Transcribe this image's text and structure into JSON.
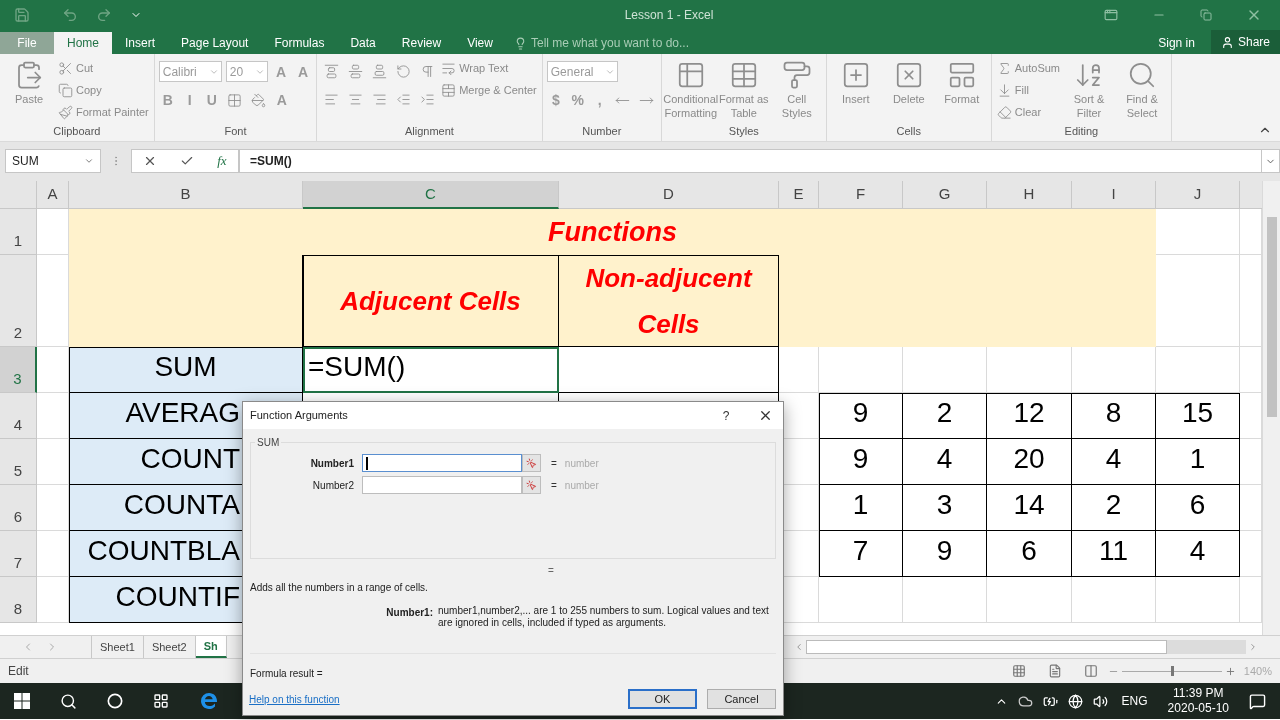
{
  "title_bar": {
    "title": "Lesson 1 - Excel"
  },
  "ribbon_tabs": [
    {
      "label": "File",
      "selected": false
    },
    {
      "label": "Home",
      "selected": true
    },
    {
      "label": "Insert",
      "selected": false
    },
    {
      "label": "Page Layout",
      "selected": false
    },
    {
      "label": "Formulas",
      "selected": false
    },
    {
      "label": "Data",
      "selected": false
    },
    {
      "label": "Review",
      "selected": false
    },
    {
      "label": "View",
      "selected": false
    }
  ],
  "tell_me": {
    "placeholder": "Tell me what you want to do..."
  },
  "account": {
    "sign_in": "Sign in",
    "share": "Share"
  },
  "ribbon_groups": [
    {
      "label": "Clipboard",
      "items": [
        {
          "kind": "large",
          "label": "Paste"
        },
        {
          "kind": "stack",
          "items": [
            {
              "label": "Cut"
            },
            {
              "label": "Copy"
            },
            {
              "label": "Format Painter"
            }
          ]
        }
      ]
    },
    {
      "label": "Font",
      "items": [
        {
          "kind": "rows",
          "lines": [
            [
              {
                "kind": "combo",
                "value": "Calibri"
              },
              {
                "kind": "combo",
                "value": "20"
              },
              {
                "kind": "glyph",
                "label": "A"
              },
              {
                "kind": "glyph",
                "label": "A"
              }
            ],
            [
              {
                "kind": "glyph",
                "label": "B"
              },
              {
                "kind": "glyph",
                "label": "I"
              },
              {
                "kind": "glyph",
                "label": "U"
              },
              {
                "kind": "icon"
              },
              {
                "kind": "icon"
              },
              {
                "kind": "glyph",
                "label": "A"
              }
            ]
          ]
        }
      ]
    },
    {
      "label": "Alignment",
      "items": [
        {
          "kind": "rows",
          "lines": [
            [
              {
                "kind": "icon"
              },
              {
                "kind": "icon"
              },
              {
                "kind": "icon"
              },
              {
                "kind": "icon"
              },
              {
                "kind": "icon"
              }
            ],
            [
              {
                "kind": "icon"
              },
              {
                "kind": "icon"
              },
              {
                "kind": "icon"
              },
              {
                "kind": "icon"
              },
              {
                "kind": "icon"
              }
            ]
          ]
        },
        {
          "kind": "stack",
          "items": [
            {
              "label": "Wrap Text"
            },
            {
              "label": "Merge & Center"
            }
          ]
        }
      ]
    },
    {
      "label": "Number",
      "items": [
        {
          "kind": "rows",
          "lines": [
            [
              {
                "kind": "combo",
                "value": "General"
              }
            ],
            [
              {
                "kind": "glyph",
                "label": "$"
              },
              {
                "kind": "glyph",
                "label": "%"
              },
              {
                "kind": "glyph",
                "label": ","
              },
              {
                "kind": "icon"
              },
              {
                "kind": "icon"
              }
            ]
          ]
        }
      ]
    },
    {
      "label": "Styles",
      "items": [
        {
          "kind": "large",
          "label": "Conditional Formatting"
        },
        {
          "kind": "large",
          "label": "Format as Table"
        },
        {
          "kind": "large",
          "label": "Cell Styles"
        }
      ]
    },
    {
      "label": "Cells",
      "items": [
        {
          "kind": "large",
          "label": "Insert"
        },
        {
          "kind": "large",
          "label": "Delete"
        },
        {
          "kind": "large",
          "label": "Format"
        }
      ]
    },
    {
      "label": "Editing",
      "items": [
        {
          "kind": "stack",
          "items": [
            {
              "label": "AutoSum"
            },
            {
              "label": "Fill"
            },
            {
              "label": "Clear"
            }
          ]
        },
        {
          "kind": "large",
          "label": "Sort & Filter"
        },
        {
          "kind": "large",
          "label": "Find & Select"
        }
      ]
    }
  ],
  "formula_bar": {
    "name_box": "SUM",
    "insert_function": "fx",
    "formula": "=SUM()"
  },
  "sheet": {
    "columns": [
      {
        "label": "A",
        "selected": false
      },
      {
        "label": "B",
        "selected": false
      },
      {
        "label": "C",
        "selected": true
      },
      {
        "label": "D",
        "selected": false
      },
      {
        "label": "E",
        "selected": false
      },
      {
        "label": "F",
        "selected": false
      },
      {
        "label": "G",
        "selected": false
      },
      {
        "label": "H",
        "selected": false
      },
      {
        "label": "I",
        "selected": false
      },
      {
        "label": "J",
        "selected": false
      }
    ],
    "rows": [
      {
        "label": "1",
        "selected": false
      },
      {
        "label": "2",
        "selected": false
      },
      {
        "label": "3",
        "selected": true
      },
      {
        "label": "4",
        "selected": false
      },
      {
        "label": "5",
        "selected": false
      },
      {
        "label": "6",
        "selected": false
      },
      {
        "label": "7",
        "selected": false
      },
      {
        "label": "8",
        "selected": false
      }
    ],
    "title": "Functions",
    "headers": [
      "Adjucent Cells",
      "Non-adjucent Cells"
    ],
    "functions": [
      "SUM",
      "AVERAG",
      "COUNT",
      "COUNTA",
      "COUNTBLA",
      "COUNTIF"
    ],
    "active_cell": "=SUM()",
    "numbers": [
      [
        "9",
        "2",
        "12",
        "8",
        "15"
      ],
      [
        "9",
        "4",
        "20",
        "4",
        "1"
      ],
      [
        "1",
        "3",
        "14",
        "2",
        "6"
      ],
      [
        "7",
        "9",
        "6",
        "11",
        "4"
      ]
    ]
  },
  "sheet_tabs": [
    {
      "label": "Sheet1",
      "selected": false
    },
    {
      "label": "Sheet2",
      "selected": false
    },
    {
      "label": "Sh",
      "selected": true
    }
  ],
  "status_bar": {
    "mode": "Edit",
    "zoom": {
      "level": 0.5,
      "reading": "140%"
    }
  },
  "dialog": {
    "title": "Function Arguments",
    "help": "?",
    "function_name": "SUM",
    "arguments": [
      {
        "label": "Number1",
        "required": true,
        "focused": true,
        "equals": "=",
        "hint": "number"
      },
      {
        "label": "Number2",
        "required": false,
        "focused": false,
        "equals": "=",
        "hint": "number"
      }
    ],
    "result_equals": "=",
    "description": "Adds all the numbers in a range of cells.",
    "argument_help": {
      "label": "Number1:",
      "text": "number1,number2,... are 1 to 255 numbers to sum. Logical values and text are ignored in cells, included if typed as arguments."
    },
    "formula_result": "Formula result =",
    "help_link": "Help on this function",
    "buttons": [
      {
        "label": "OK",
        "default": true
      },
      {
        "label": "Cancel",
        "default": false
      }
    ]
  },
  "taskbar": {
    "language": "ENG",
    "time": "11:39 PM",
    "date": "2020-05-10"
  }
}
